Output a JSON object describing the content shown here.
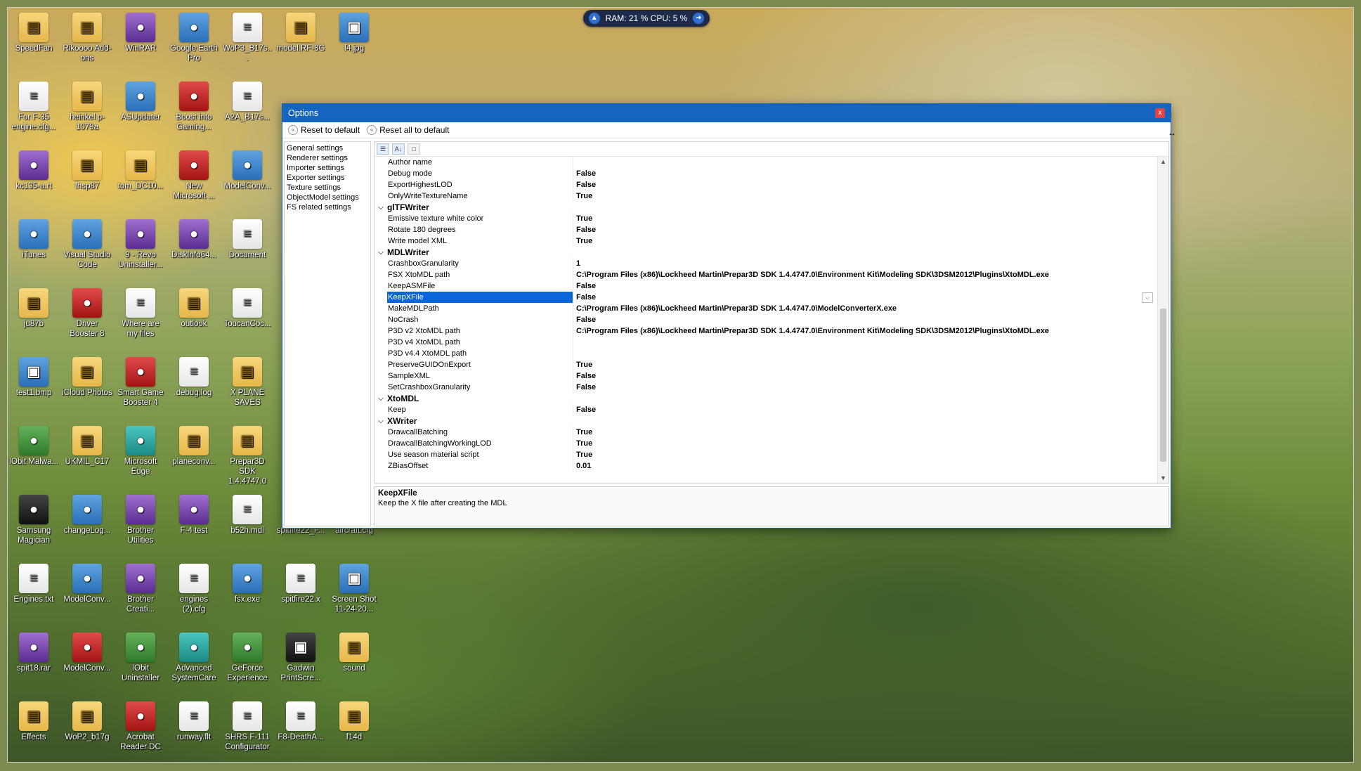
{
  "sysmon": {
    "text": "RAM: 21 %  CPU: 5 %"
  },
  "desktop_icons": [
    {
      "label": "SpeedFan",
      "icon": "folder-icon"
    },
    {
      "label": "Rikoooo Add-ons",
      "icon": "folder-icon"
    },
    {
      "label": "WinRAR",
      "icon": "winrar-icon"
    },
    {
      "label": "Google Earth Pro",
      "icon": "google-earth-icon"
    },
    {
      "label": "WoP3_B17s...",
      "icon": "file-icon"
    },
    {
      "label": "model.RF-8G",
      "icon": "folder-icon"
    },
    {
      "label": "f4.jpg",
      "icon": "image-icon"
    },
    {
      "label": "For F-35 engine.cfg...",
      "icon": "file-icon"
    },
    {
      "label": "heinkel p-1079a",
      "icon": "folder-icon"
    },
    {
      "label": "ASUpdater",
      "icon": "asus-icon"
    },
    {
      "label": "Boost into Gaming...",
      "icon": "boost-icon"
    },
    {
      "label": "A2A_B17s...",
      "icon": "file-icon"
    },
    {
      "label": "kc135-a.rt",
      "icon": "winrar-icon"
    },
    {
      "label": "fhsp87",
      "icon": "folder-icon"
    },
    {
      "label": "tom_DC10...",
      "icon": "folder-icon"
    },
    {
      "label": "New Microsoft ...",
      "icon": "access-icon"
    },
    {
      "label": "ModelConv...",
      "icon": "modelconv-icon"
    },
    {
      "label": "iTunes",
      "icon": "itunes-icon"
    },
    {
      "label": "Visual Studio Code",
      "icon": "vscode-icon"
    },
    {
      "label": "9 - Revo Uninstaller...",
      "icon": "revo-icon"
    },
    {
      "label": "DiskInfo64...",
      "icon": "diskinfo-icon"
    },
    {
      "label": "Document",
      "icon": "document-icon"
    },
    {
      "label": "ju87b",
      "icon": "folder-icon"
    },
    {
      "label": "Driver Booster 8",
      "icon": "driver-booster-icon"
    },
    {
      "label": "Where are my files",
      "icon": "file-icon"
    },
    {
      "label": "outlook",
      "icon": "folder-icon"
    },
    {
      "label": "ToucanCoc...",
      "icon": "file-icon"
    },
    {
      "label": "test1.bmp",
      "icon": "image-icon"
    },
    {
      "label": "iCloud Photos",
      "icon": "folder-icon"
    },
    {
      "label": "Smart Game Booster 4",
      "icon": "boost-icon"
    },
    {
      "label": "debug.log",
      "icon": "file-icon"
    },
    {
      "label": "X PLANE SAVES",
      "icon": "folder-icon"
    },
    {
      "label": "IObit Malwa...",
      "icon": "iobit-icon"
    },
    {
      "label": "UKMIL_C17",
      "icon": "folder-icon"
    },
    {
      "label": "Microsoft Edge",
      "icon": "edge-icon"
    },
    {
      "label": "planeconv...",
      "icon": "folder-icon"
    },
    {
      "label": "Prepar3D SDK 1.4.4747.0",
      "icon": "folder-icon"
    },
    {
      "label": "Samsung Magician",
      "icon": "samsung-icon"
    },
    {
      "label": "changeLog...",
      "icon": "chrome-icon"
    },
    {
      "label": "Brother Utilities",
      "icon": "brother-icon"
    },
    {
      "label": "F-4 test",
      "icon": "winrar-icon"
    },
    {
      "label": "b52h.mdl",
      "icon": "file-icon"
    },
    {
      "label": "spitfire22_F...",
      "icon": "file-icon"
    },
    {
      "label": "aircraft.cfg",
      "icon": "file-icon"
    },
    {
      "label": "Engines.txt",
      "icon": "file-icon"
    },
    {
      "label": "ModelConv...",
      "icon": "modelconv-icon"
    },
    {
      "label": "Brother Creati...",
      "icon": "brother-icon"
    },
    {
      "label": "engines (2).cfg",
      "icon": "file-icon"
    },
    {
      "label": "fsx.exe",
      "icon": "fsx-icon"
    },
    {
      "label": "spitfire22.x",
      "icon": "file-icon"
    },
    {
      "label": "Screen Shot 11-24-20...",
      "icon": "image-icon"
    },
    {
      "label": "spit18.rar",
      "icon": "winrar-icon"
    },
    {
      "label": "ModelConv...",
      "icon": "pdf-icon"
    },
    {
      "label": "IObit Uninstaller",
      "icon": "iobit-icon"
    },
    {
      "label": "Advanced SystemCare",
      "icon": "asc-icon"
    },
    {
      "label": "GeForce Experience",
      "icon": "geforce-icon"
    },
    {
      "label": "Gadwin PrintScre...",
      "icon": "camera-icon"
    },
    {
      "label": "sound",
      "icon": "folder-icon"
    },
    {
      "label": "Effects",
      "icon": "folder-icon"
    },
    {
      "label": "WoP2_b17g",
      "icon": "folder-icon"
    },
    {
      "label": "Acrobat Reader DC",
      "icon": "acrobat-icon"
    },
    {
      "label": "runway.flt",
      "icon": "file-icon"
    },
    {
      "label": "SHRS F-111 Configurator",
      "icon": "file-icon"
    },
    {
      "label": "F8-DeathA...",
      "icon": "file-icon"
    },
    {
      "label": "f14d",
      "icon": "folder-icon"
    }
  ],
  "options": {
    "title": "Options",
    "close_label": "x",
    "toolbar": {
      "reset": "Reset to default",
      "reset_all": "Reset all to default"
    },
    "nav": [
      "General settings",
      "Renderer settings",
      "Importer settings",
      "Exporter settings",
      "Texture settings",
      "ObjectModel settings",
      "FS related settings"
    ],
    "rows": [
      {
        "type": "prop",
        "name": "Author name",
        "value": ""
      },
      {
        "type": "prop",
        "name": "Debug mode",
        "value": "False"
      },
      {
        "type": "prop",
        "name": "ExportHighestLOD",
        "value": "False"
      },
      {
        "type": "prop",
        "name": "OnlyWriteTextureName",
        "value": "True"
      },
      {
        "type": "cat",
        "name": "glTFWriter",
        "value": ""
      },
      {
        "type": "prop",
        "name": "Emissive texture white color",
        "value": "True"
      },
      {
        "type": "prop",
        "name": "Rotate 180 degrees",
        "value": "False"
      },
      {
        "type": "prop",
        "name": "Write model XML",
        "value": "True"
      },
      {
        "type": "cat",
        "name": "MDLWriter",
        "value": ""
      },
      {
        "type": "prop",
        "name": "CrashboxGranularity",
        "value": "1"
      },
      {
        "type": "prop",
        "name": "FSX XtoMDL path",
        "value": "C:\\Program Files (x86)\\Lockheed Martin\\Prepar3D SDK 1.4.4747.0\\Environment Kit\\Modeling SDK\\3DSM2012\\Plugins\\XtoMDL.exe"
      },
      {
        "type": "prop",
        "name": "KeepASMFile",
        "value": "False"
      },
      {
        "type": "prop",
        "name": "KeepXFile",
        "value": "False",
        "selected": true
      },
      {
        "type": "prop",
        "name": "MakeMDLPath",
        "value": "C:\\Program Files (x86)\\Lockheed Martin\\Prepar3D SDK 1.4.4747.0\\ModelConverterX.exe"
      },
      {
        "type": "prop",
        "name": "NoCrash",
        "value": "False"
      },
      {
        "type": "prop",
        "name": "P3D v2 XtoMDL path",
        "value": "C:\\Program Files (x86)\\Lockheed Martin\\Prepar3D SDK 1.4.4747.0\\Environment Kit\\Modeling SDK\\3DSM2012\\Plugins\\XtoMDL.exe"
      },
      {
        "type": "prop",
        "name": "P3D v4 XtoMDL path",
        "value": ""
      },
      {
        "type": "prop",
        "name": "P3D v4.4 XtoMDL path",
        "value": ""
      },
      {
        "type": "prop",
        "name": "PreserveGUIDOnExport",
        "value": "True"
      },
      {
        "type": "prop",
        "name": "SampleXML",
        "value": "False"
      },
      {
        "type": "prop",
        "name": "SetCrashboxGranularity",
        "value": "False"
      },
      {
        "type": "cat",
        "name": "XtoMDL",
        "value": ""
      },
      {
        "type": "prop",
        "name": "Keep",
        "value": "False"
      },
      {
        "type": "cat",
        "name": "XWriter",
        "value": ""
      },
      {
        "type": "prop",
        "name": "DrawcallBatching",
        "value": "True"
      },
      {
        "type": "prop",
        "name": "DrawcallBatchingWorkingLOD",
        "value": "True"
      },
      {
        "type": "prop",
        "name": "Use season material script",
        "value": "True"
      },
      {
        "type": "prop",
        "name": "ZBiasOffset",
        "value": "0.01"
      }
    ],
    "description": {
      "title": "KeepXFile",
      "text": "Keep the X file after creating the MDL"
    }
  },
  "colors": {
    "title_bar": "#1565c0",
    "selection": "#0a66d8",
    "close": "#e04343"
  }
}
